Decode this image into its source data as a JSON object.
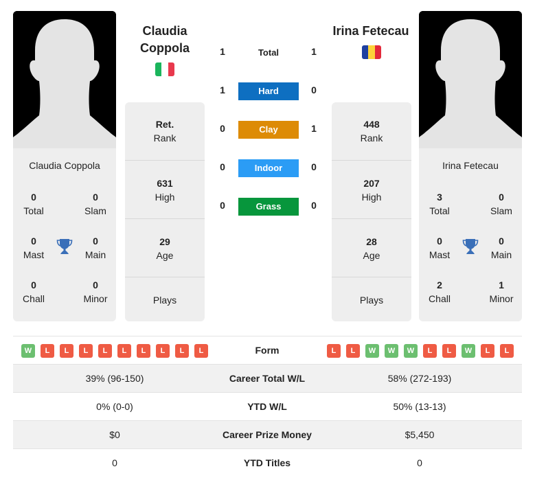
{
  "colors": {
    "hard": "#0e6fc1",
    "clay": "#dd8b06",
    "indoor": "#2b9cf5",
    "grass": "#07963c",
    "win": "#6cbf70",
    "loss": "#ef5b44",
    "trophy": "#3a6fb8"
  },
  "player1": {
    "name": "Claudia Coppola",
    "name_line1": "Claudia",
    "name_line2": "Coppola",
    "flag": {
      "country": "Italy",
      "colors": [
        "#1bb55c",
        "#eeeeee",
        "#e8394d"
      ]
    },
    "titles": {
      "total": "0",
      "total_label": "Total",
      "slam": "0",
      "slam_label": "Slam",
      "mast": "0",
      "mast_label": "Mast",
      "main": "0",
      "main_label": "Main",
      "chall": "0",
      "chall_label": "Chall",
      "minor": "0",
      "minor_label": "Minor"
    },
    "rank": "Ret.",
    "rank_label": "Rank",
    "high": "631",
    "high_label": "High",
    "age": "29",
    "age_label": "Age",
    "plays": "",
    "plays_label": "Plays",
    "form": [
      "W",
      "L",
      "L",
      "L",
      "L",
      "L",
      "L",
      "L",
      "L",
      "L"
    ],
    "career_wl": "39% (96-150)",
    "ytd_wl": "0% (0-0)",
    "prize": "$0",
    "ytd_titles": "0"
  },
  "player2": {
    "name": "Irina Fetecau",
    "flag": {
      "country": "Romania",
      "colors": [
        "#1e3fa0",
        "#fdd33a",
        "#e3293b"
      ]
    },
    "titles": {
      "total": "3",
      "total_label": "Total",
      "slam": "0",
      "slam_label": "Slam",
      "mast": "0",
      "mast_label": "Mast",
      "main": "0",
      "main_label": "Main",
      "chall": "2",
      "chall_label": "Chall",
      "minor": "1",
      "minor_label": "Minor"
    },
    "rank": "448",
    "rank_label": "Rank",
    "high": "207",
    "high_label": "High",
    "age": "28",
    "age_label": "Age",
    "plays": "",
    "plays_label": "Plays",
    "form": [
      "L",
      "L",
      "W",
      "W",
      "W",
      "L",
      "L",
      "W",
      "L",
      "L"
    ],
    "career_wl": "58% (272-193)",
    "ytd_wl": "50% (13-13)",
    "prize": "$5,450",
    "ytd_titles": "0"
  },
  "h2h": [
    {
      "label": "Total",
      "left": "1",
      "right": "1",
      "type": "total"
    },
    {
      "label": "Hard",
      "left": "1",
      "right": "0",
      "type": "hard"
    },
    {
      "label": "Clay",
      "left": "0",
      "right": "1",
      "type": "clay"
    },
    {
      "label": "Indoor",
      "left": "0",
      "right": "0",
      "type": "indoor"
    },
    {
      "label": "Grass",
      "left": "0",
      "right": "0",
      "type": "grass"
    }
  ],
  "stats_labels": {
    "form": "Form",
    "career_wl": "Career Total W/L",
    "ytd_wl": "YTD W/L",
    "prize": "Career Prize Money",
    "ytd_titles": "YTD Titles"
  },
  "icons": {
    "photo": "player-silhouette-icon",
    "trophy": "trophy-icon"
  }
}
